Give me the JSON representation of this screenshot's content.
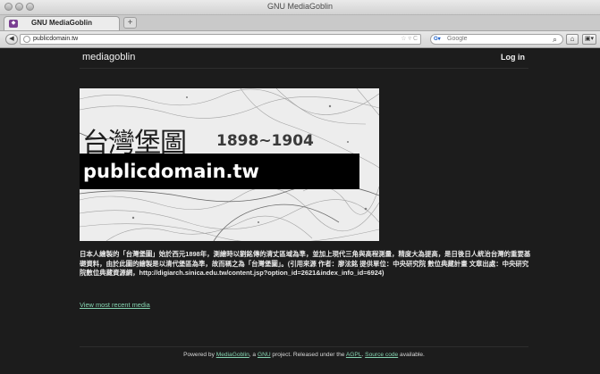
{
  "window": {
    "title": "GNU MediaGoblin"
  },
  "tab": {
    "title": "GNU MediaGoblin",
    "favicon_icon": "goblin-favicon-icon"
  },
  "toolbar": {
    "url": "publicdomain.tw",
    "search_engine": "Google",
    "search_placeholder": "Google"
  },
  "header": {
    "logo": "mediagoblin",
    "login_label": "Log in"
  },
  "media": {
    "image_title_cn": "台灣堡圖",
    "image_years": "1898~1904",
    "image_banner": "publicdomain.tw",
    "description": "日本人繪製的「台灣堡圖」始於西元1898年，測繪時以劉銘傳的清丈區域為準，並加上現代三角與高程測量，精度大為提高，是日後日人統治台灣的重要基礎資料，由於此圖的繪製是以清代堡區為準，故而稱之為「台灣堡圖」。(引用來源 作者：廖泫銘 提供單位：中央研究院 數位典藏計畫 文章出處：中央研究院數位典藏資源網，http://digiarch.sinica.edu.tw/content.jsp?option_id=2621&index_info_id=6924)",
    "recent_link": "View most recent media"
  },
  "footer": {
    "part1": "Powered by ",
    "mediagoblin_link": "MediaGoblin",
    "part2": ", a ",
    "gnu_link": "GNU",
    "part3": " project. Released under the ",
    "agpl_link": "AGPL",
    "part4": ". ",
    "source_link": "Source code",
    "part5": " available."
  },
  "colors": {
    "background": "#1c1c1c",
    "link": "#86d4b1"
  }
}
